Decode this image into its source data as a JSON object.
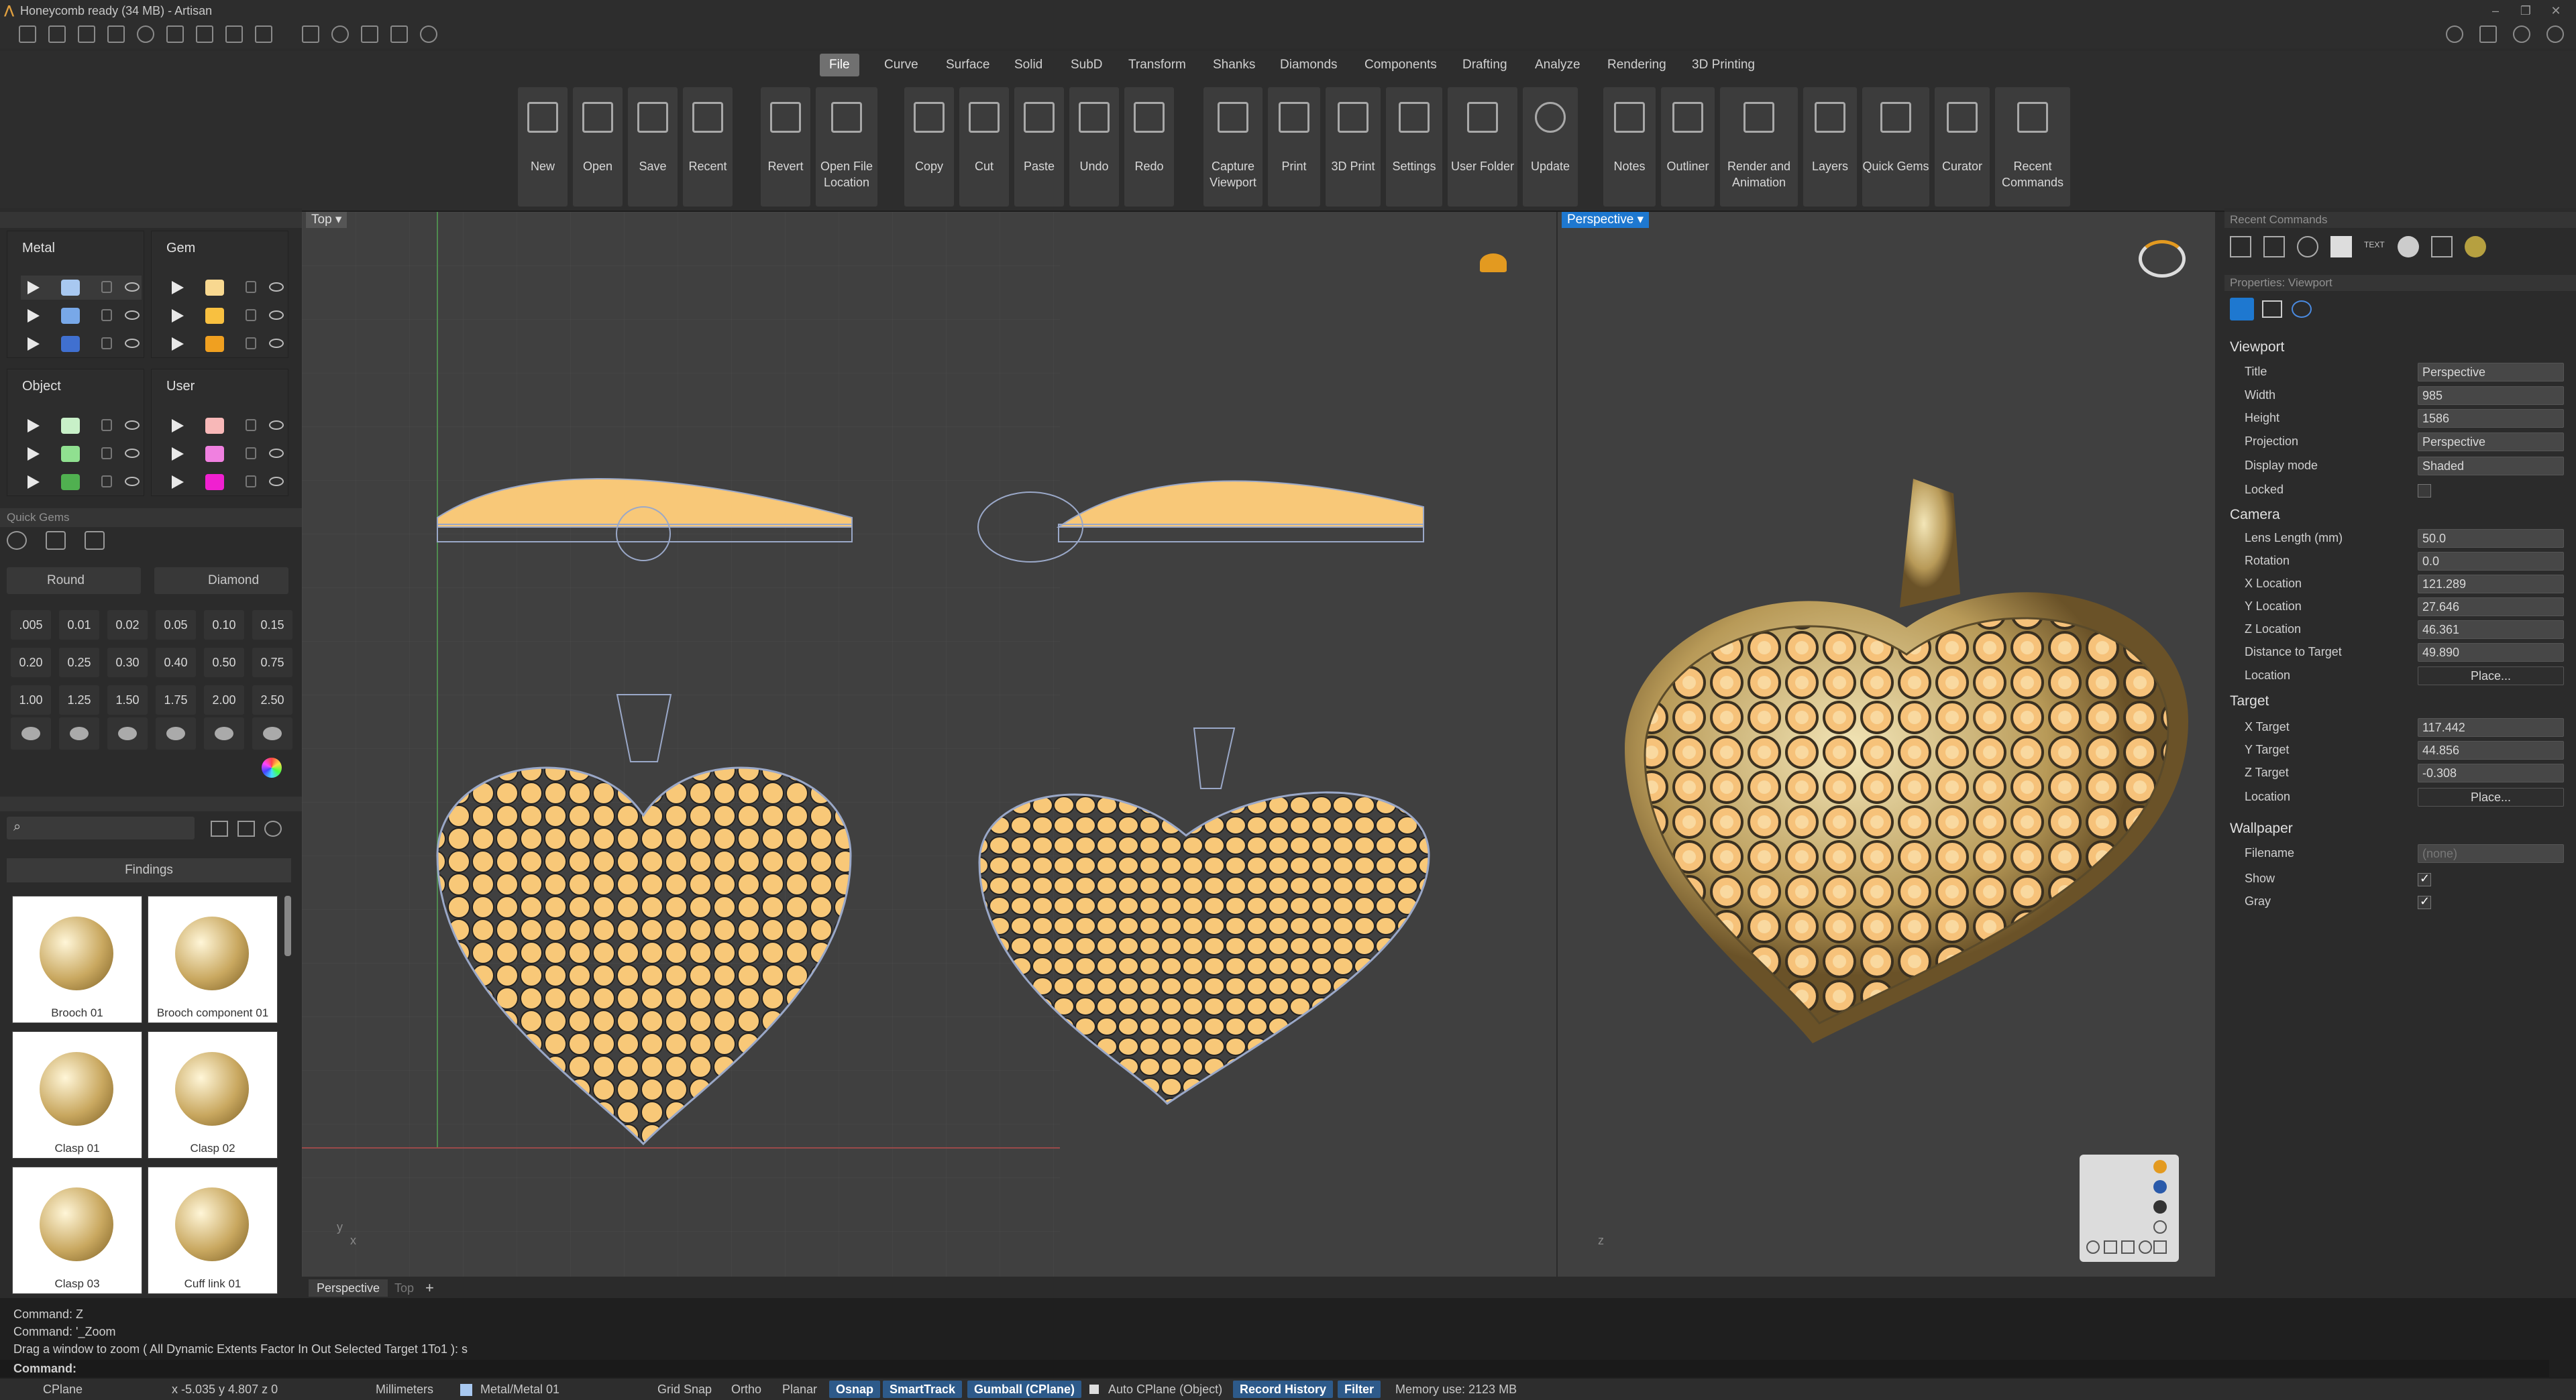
{
  "app": {
    "title": "Honeycomb ready (34 MB) - Artisan",
    "brand_color": "#e0a040"
  },
  "window_controls": [
    "minimize-icon",
    "restore-icon",
    "close-icon"
  ],
  "tabs": [
    {
      "label": "File",
      "active": true
    },
    {
      "label": "Curve"
    },
    {
      "label": "Surface"
    },
    {
      "label": "Solid"
    },
    {
      "label": "SubD"
    },
    {
      "label": "Transform"
    },
    {
      "label": "Shanks"
    },
    {
      "label": "Diamonds"
    },
    {
      "label": "Components"
    },
    {
      "label": "Drafting"
    },
    {
      "label": "Analyze"
    },
    {
      "label": "Rendering"
    },
    {
      "label": "3D Printing"
    }
  ],
  "ribbon": [
    {
      "label": "New"
    },
    {
      "label": "Open"
    },
    {
      "label": "Save"
    },
    {
      "label": "Recent"
    },
    {
      "label": "Revert"
    },
    {
      "label": "Open File Location"
    },
    {
      "label": "Copy"
    },
    {
      "label": "Cut"
    },
    {
      "label": "Paste"
    },
    {
      "label": "Undo"
    },
    {
      "label": "Redo"
    },
    {
      "label": "Capture Viewport"
    },
    {
      "label": "Print"
    },
    {
      "label": "3D Print"
    },
    {
      "label": "Settings"
    },
    {
      "label": "User Folder"
    },
    {
      "label": "Update"
    },
    {
      "label": "Notes"
    },
    {
      "label": "Outliner"
    },
    {
      "label": "Render and Animation"
    },
    {
      "label": "Layers"
    },
    {
      "label": "Quick Gems"
    },
    {
      "label": "Curator"
    },
    {
      "label": "Recent Commands"
    }
  ],
  "layers": {
    "groups": [
      {
        "title": "Metal",
        "colors": [
          "#a8c8f0",
          "#78a8e8",
          "#4070d0"
        ]
      },
      {
        "title": "Gem",
        "colors": [
          "#f8d890",
          "#f8c040",
          "#f0a020"
        ]
      },
      {
        "title": "Object",
        "colors": [
          "#c8f0c8",
          "#90e090",
          "#50b050"
        ]
      },
      {
        "title": "User",
        "colors": [
          "#f8b8b8",
          "#f080e0",
          "#f020d0"
        ]
      }
    ]
  },
  "quick_gems": {
    "header": "Quick Gems",
    "shape": "Round",
    "type": "Diamond",
    "sizes": [
      ".005",
      "0.01",
      "0.02",
      "0.05",
      "0.10",
      "0.15",
      "0.20",
      "0.25",
      "0.30",
      "0.40",
      "0.50",
      "0.75",
      "1.00",
      "1.25",
      "1.50",
      "1.75",
      "2.00",
      "2.50"
    ]
  },
  "findings": {
    "title": "Findings",
    "items": [
      "Brooch 01",
      "Brooch component 01",
      "Clasp 01",
      "Clasp 02",
      "Clasp 03",
      "Cuff link 01"
    ]
  },
  "viewports": {
    "left_title": "Top",
    "right_title": "Perspective",
    "tabs": [
      "Perspective",
      "Top"
    ]
  },
  "right_panel": {
    "recent_commands_header": "Recent Commands",
    "properties_header": "Properties: Viewport",
    "sections": {
      "viewport": "Viewport",
      "camera": "Camera",
      "target": "Target",
      "wallpaper": "Wallpaper"
    },
    "viewport": {
      "Title": "Perspective",
      "Width": "985",
      "Height": "1586",
      "Projection": "Perspective",
      "Display mode": "Shaded"
    },
    "camera": {
      "Lens Length (mm)": "50.0",
      "Rotation": "0.0",
      "X Location": "121.289",
      "Y Location": "27.646",
      "Z Location": "46.361",
      "Distance to Target": "49.890",
      "Location": "Place..."
    },
    "target": {
      "X Target": "117.442",
      "Y Target": "44.856",
      "Z Target": "-0.308",
      "Location": "Place..."
    },
    "wallpaper": {
      "Filename": "(none)",
      "Show": true,
      "Gray": true
    },
    "labels": {
      "title": "Title",
      "width": "Width",
      "height": "Height",
      "projection": "Projection",
      "display": "Display mode",
      "locked": "Locked",
      "lens": "Lens Length (mm)",
      "rotation": "Rotation",
      "xloc": "X Location",
      "yloc": "Y Location",
      "zloc": "Z Location",
      "dist": "Distance to Target",
      "location": "Location",
      "xt": "X Target",
      "yt": "Y Target",
      "zt": "Z Target",
      "filename": "Filename",
      "show": "Show",
      "gray": "Gray"
    }
  },
  "command": {
    "history": [
      "Command: Z",
      "Command: '_Zoom",
      "Drag a window to zoom ( All  Dynamic  Extents  Factor  In  Out  Selected  Target  1To1 ): s"
    ],
    "prompt": "Command:"
  },
  "status": {
    "cplane": "CPlane",
    "coords": "x -5.035  y 4.807  z 0",
    "units": "Millimeters",
    "layer": "Metal/Metal 01",
    "grid_snap": "Grid Snap",
    "ortho": "Ortho",
    "planar": "Planar",
    "osnap": "Osnap",
    "smarttrack": "SmartTrack",
    "gumball": "Gumball (CPlane)",
    "autocplane": "Auto CPlane (Object)",
    "record": "Record History",
    "filter": "Filter",
    "memory": "Memory use: 2123 MB"
  },
  "colors": {
    "gem": "#f8c878",
    "metal": "#c8b070",
    "wire": "#9aa8c8",
    "highlight": "#2d5a8a"
  }
}
